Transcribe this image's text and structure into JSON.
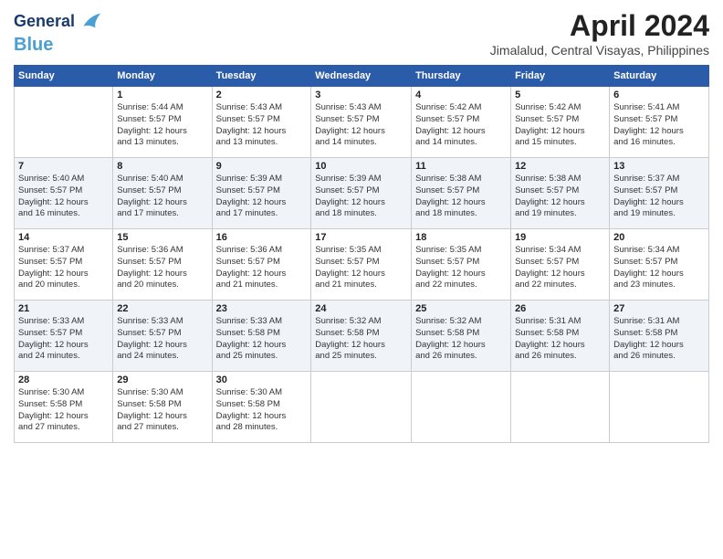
{
  "header": {
    "logo_line1": "General",
    "logo_line2": "Blue",
    "month_title": "April 2024",
    "location": "Jimalalud, Central Visayas, Philippines"
  },
  "calendar": {
    "days_of_week": [
      "Sunday",
      "Monday",
      "Tuesday",
      "Wednesday",
      "Thursday",
      "Friday",
      "Saturday"
    ],
    "weeks": [
      [
        {
          "day": "",
          "info": ""
        },
        {
          "day": "1",
          "info": "Sunrise: 5:44 AM\nSunset: 5:57 PM\nDaylight: 12 hours\nand 13 minutes."
        },
        {
          "day": "2",
          "info": "Sunrise: 5:43 AM\nSunset: 5:57 PM\nDaylight: 12 hours\nand 13 minutes."
        },
        {
          "day": "3",
          "info": "Sunrise: 5:43 AM\nSunset: 5:57 PM\nDaylight: 12 hours\nand 14 minutes."
        },
        {
          "day": "4",
          "info": "Sunrise: 5:42 AM\nSunset: 5:57 PM\nDaylight: 12 hours\nand 14 minutes."
        },
        {
          "day": "5",
          "info": "Sunrise: 5:42 AM\nSunset: 5:57 PM\nDaylight: 12 hours\nand 15 minutes."
        },
        {
          "day": "6",
          "info": "Sunrise: 5:41 AM\nSunset: 5:57 PM\nDaylight: 12 hours\nand 16 minutes."
        }
      ],
      [
        {
          "day": "7",
          "info": "Sunrise: 5:40 AM\nSunset: 5:57 PM\nDaylight: 12 hours\nand 16 minutes."
        },
        {
          "day": "8",
          "info": "Sunrise: 5:40 AM\nSunset: 5:57 PM\nDaylight: 12 hours\nand 17 minutes."
        },
        {
          "day": "9",
          "info": "Sunrise: 5:39 AM\nSunset: 5:57 PM\nDaylight: 12 hours\nand 17 minutes."
        },
        {
          "day": "10",
          "info": "Sunrise: 5:39 AM\nSunset: 5:57 PM\nDaylight: 12 hours\nand 18 minutes."
        },
        {
          "day": "11",
          "info": "Sunrise: 5:38 AM\nSunset: 5:57 PM\nDaylight: 12 hours\nand 18 minutes."
        },
        {
          "day": "12",
          "info": "Sunrise: 5:38 AM\nSunset: 5:57 PM\nDaylight: 12 hours\nand 19 minutes."
        },
        {
          "day": "13",
          "info": "Sunrise: 5:37 AM\nSunset: 5:57 PM\nDaylight: 12 hours\nand 19 minutes."
        }
      ],
      [
        {
          "day": "14",
          "info": "Sunrise: 5:37 AM\nSunset: 5:57 PM\nDaylight: 12 hours\nand 20 minutes."
        },
        {
          "day": "15",
          "info": "Sunrise: 5:36 AM\nSunset: 5:57 PM\nDaylight: 12 hours\nand 20 minutes."
        },
        {
          "day": "16",
          "info": "Sunrise: 5:36 AM\nSunset: 5:57 PM\nDaylight: 12 hours\nand 21 minutes."
        },
        {
          "day": "17",
          "info": "Sunrise: 5:35 AM\nSunset: 5:57 PM\nDaylight: 12 hours\nand 21 minutes."
        },
        {
          "day": "18",
          "info": "Sunrise: 5:35 AM\nSunset: 5:57 PM\nDaylight: 12 hours\nand 22 minutes."
        },
        {
          "day": "19",
          "info": "Sunrise: 5:34 AM\nSunset: 5:57 PM\nDaylight: 12 hours\nand 22 minutes."
        },
        {
          "day": "20",
          "info": "Sunrise: 5:34 AM\nSunset: 5:57 PM\nDaylight: 12 hours\nand 23 minutes."
        }
      ],
      [
        {
          "day": "21",
          "info": "Sunrise: 5:33 AM\nSunset: 5:57 PM\nDaylight: 12 hours\nand 24 minutes."
        },
        {
          "day": "22",
          "info": "Sunrise: 5:33 AM\nSunset: 5:57 PM\nDaylight: 12 hours\nand 24 minutes."
        },
        {
          "day": "23",
          "info": "Sunrise: 5:33 AM\nSunset: 5:58 PM\nDaylight: 12 hours\nand 25 minutes."
        },
        {
          "day": "24",
          "info": "Sunrise: 5:32 AM\nSunset: 5:58 PM\nDaylight: 12 hours\nand 25 minutes."
        },
        {
          "day": "25",
          "info": "Sunrise: 5:32 AM\nSunset: 5:58 PM\nDaylight: 12 hours\nand 26 minutes."
        },
        {
          "day": "26",
          "info": "Sunrise: 5:31 AM\nSunset: 5:58 PM\nDaylight: 12 hours\nand 26 minutes."
        },
        {
          "day": "27",
          "info": "Sunrise: 5:31 AM\nSunset: 5:58 PM\nDaylight: 12 hours\nand 26 minutes."
        }
      ],
      [
        {
          "day": "28",
          "info": "Sunrise: 5:30 AM\nSunset: 5:58 PM\nDaylight: 12 hours\nand 27 minutes."
        },
        {
          "day": "29",
          "info": "Sunrise: 5:30 AM\nSunset: 5:58 PM\nDaylight: 12 hours\nand 27 minutes."
        },
        {
          "day": "30",
          "info": "Sunrise: 5:30 AM\nSunset: 5:58 PM\nDaylight: 12 hours\nand 28 minutes."
        },
        {
          "day": "",
          "info": ""
        },
        {
          "day": "",
          "info": ""
        },
        {
          "day": "",
          "info": ""
        },
        {
          "day": "",
          "info": ""
        }
      ]
    ]
  }
}
